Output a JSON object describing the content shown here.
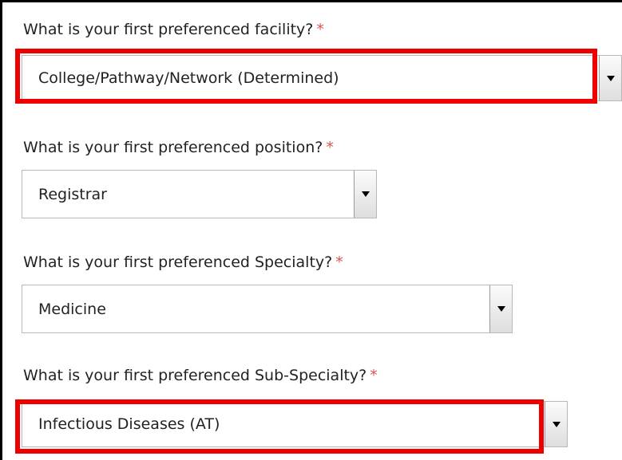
{
  "questions": [
    {
      "label": "What is your first preferenced facility?",
      "required": "*",
      "value": "College/Pathway/Network (Determined)",
      "highlighted": true
    },
    {
      "label": "What is your first preferenced position?",
      "required": "*",
      "value": "Registrar",
      "highlighted": false
    },
    {
      "label": "What is your first preferenced Specialty?",
      "required": "*",
      "value": "Medicine",
      "highlighted": false
    },
    {
      "label": "What is your first preferenced Sub-Specialty?",
      "required": "*",
      "value": "Infectious Diseases (AT)",
      "highlighted": true
    }
  ],
  "colors": {
    "highlight": "#ee0000",
    "required": "#d9534f"
  },
  "icons": {
    "dropdown_arrow": "caret-down-icon"
  }
}
